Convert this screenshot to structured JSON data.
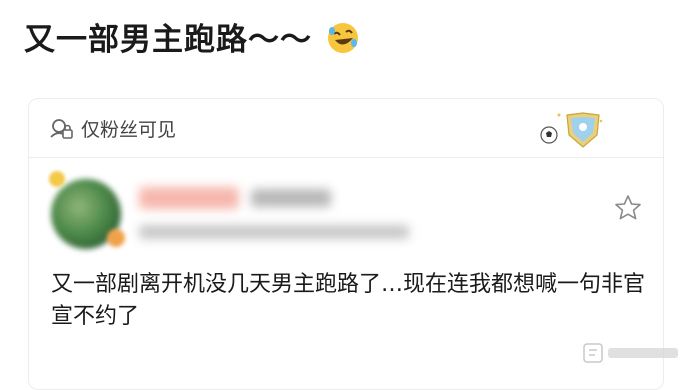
{
  "post": {
    "title": "又一部男主跑路～～",
    "title_emoji": "rolling-on-floor-laughing-emoji",
    "visibility_label": "仅粉丝可见",
    "comment_text": "又一部剧离开机没几天男主跑路了…现在连我都想喊一句非官宣不约了"
  },
  "icons": {
    "visibility": "lock-person-icon",
    "badge": "soccer-ball-shield-badge-icon",
    "favorite": "star-outline-icon"
  },
  "colors": {
    "text": "#1a1a1a",
    "muted": "#444444",
    "border": "#ececec",
    "emoji": "#f7c63c"
  }
}
